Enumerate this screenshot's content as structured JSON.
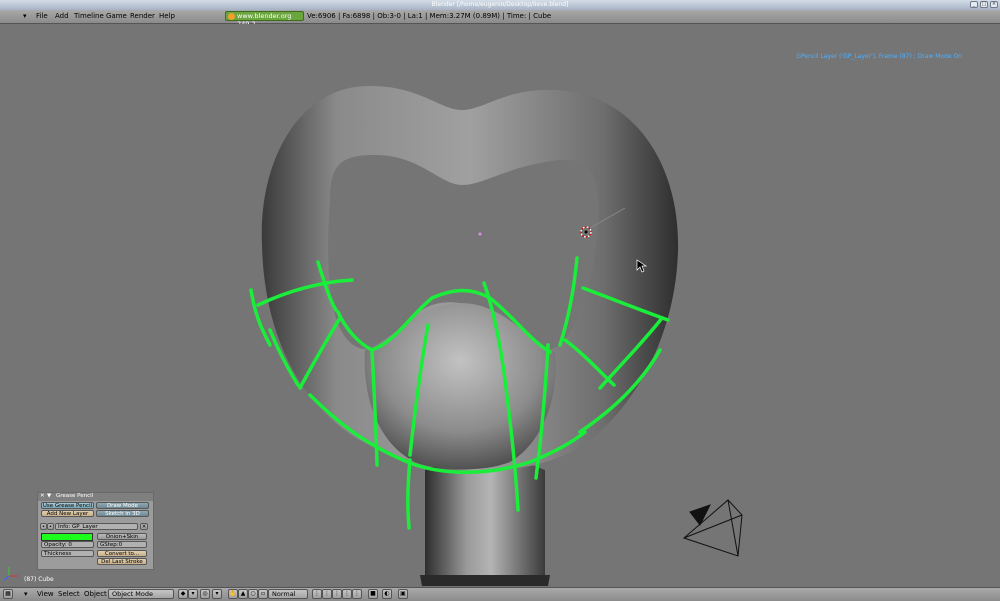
{
  "window": {
    "title": "Blender [/home/eugenio/Desktop/lieve.blend]"
  },
  "menu": {
    "file": "File",
    "add": "Add",
    "timeline": "Timeline",
    "game": "Game",
    "render": "Render",
    "help": "Help"
  },
  "header": {
    "url": "www.blender.org 249.2",
    "stats": "Ve:6906 | Fa:6898 | Ob:3-0 | La:1   | Mem:3.27M (0.89M)  | Time:  | Cube"
  },
  "viewport": {
    "gpencil_info": "GPencil Layer ('GP_Layer'), Frame (87) ; Draw Mode On",
    "status": "(87) Cube",
    "stroke_color": "#1bee3a"
  },
  "gpencil_panel": {
    "title": "Grease Pencil",
    "use_gp": "Use Grease Pencil",
    "draw_mode": "Draw Mode",
    "add_layer": "Add New Layer",
    "sketch_3d": "Sketch in 3D",
    "layer_name": "Info: GP_Layer",
    "onion": "Onion+Skin",
    "opacity": "Opacity: 0",
    "gstep": "GStep:0",
    "thickness": "Thickness",
    "convert": "Convert to...",
    "del_last": "Del Last Stroke",
    "color": "#1bff1b"
  },
  "bottom": {
    "view": "View",
    "select": "Select",
    "object": "Object",
    "mode": "Object Mode",
    "shading": "Normal"
  }
}
